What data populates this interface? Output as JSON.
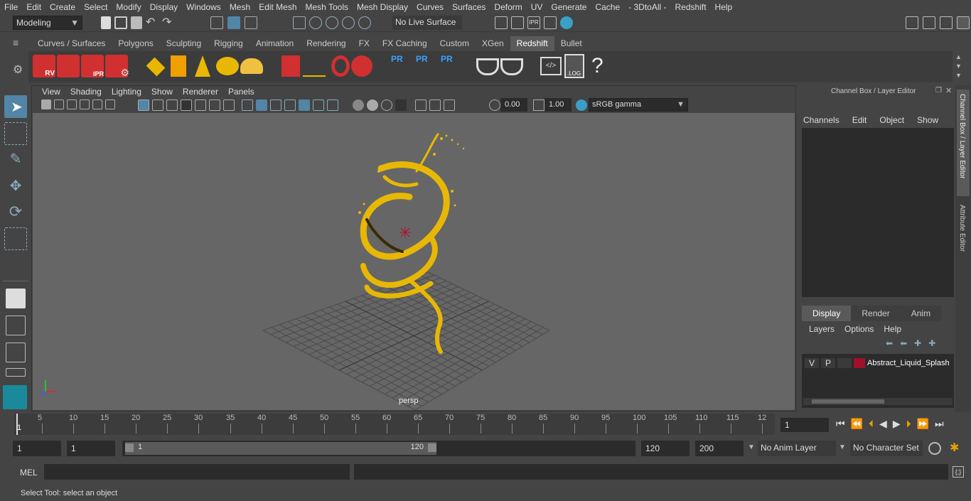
{
  "menubar": [
    "File",
    "Edit",
    "Create",
    "Select",
    "Modify",
    "Display",
    "Windows",
    "Mesh",
    "Edit Mesh",
    "Mesh Tools",
    "Mesh Display",
    "Curves",
    "Surfaces",
    "Deform",
    "UV",
    "Generate",
    "Cache",
    "- 3DtoAll -",
    "Redshift",
    "Help"
  ],
  "statusline": {
    "workspace": "Modeling",
    "live_surface": "No Live Surface"
  },
  "shelf_tabs": [
    "Curves / Surfaces",
    "Polygons",
    "Sculpting",
    "Rigging",
    "Animation",
    "Rendering",
    "FX",
    "FX Caching",
    "Custom",
    "XGen",
    "Redshift",
    "Bullet"
  ],
  "active_shelf_tab": "Redshift",
  "shelf": {
    "rv": "RV",
    "ipr": "IPR",
    "pr": "PR",
    "log": ".LOG",
    "help": "?"
  },
  "viewport": {
    "menu": [
      "View",
      "Shading",
      "Lighting",
      "Show",
      "Renderer",
      "Panels"
    ],
    "exposure": "0.00",
    "gamma": "1.00",
    "color_space": "sRGB gamma",
    "camera_label": "persp"
  },
  "channel_box": {
    "title": "Channel Box / Layer Editor",
    "menu": [
      "Channels",
      "Edit",
      "Object",
      "Show"
    ],
    "layer_tabs": [
      "Display",
      "Render",
      "Anim"
    ],
    "active_layer_tab": "Display",
    "layer_menu": [
      "Layers",
      "Options",
      "Help"
    ],
    "layer": {
      "v": "V",
      "p": "P",
      "name": "Abstract_Liquid_Splash",
      "color": "#a0102a"
    }
  },
  "side_tabs": [
    "Channel Box / Layer Editor",
    "Attribute Editor"
  ],
  "timeline": {
    "ticks": [
      "5",
      "10",
      "15",
      "20",
      "25",
      "30",
      "35",
      "40",
      "45",
      "50",
      "55",
      "60",
      "65",
      "70",
      "75",
      "80",
      "85",
      "90",
      "95",
      "100",
      "105",
      "110",
      "115",
      "12"
    ],
    "start_label": "1",
    "current_frame": "1"
  },
  "range": {
    "start": "1",
    "playback_start": "1",
    "slider_start": "1",
    "slider_end": "120",
    "playback_end": "120",
    "end": "200",
    "anim_layer": "No Anim Layer",
    "character_set": "No Character Set"
  },
  "cmdline": {
    "lang": "MEL"
  },
  "help_line": "Select Tool: select an object",
  "colors": {
    "splash": "#e8b800",
    "accent": "#5285a6",
    "redshift": "#d03030"
  }
}
